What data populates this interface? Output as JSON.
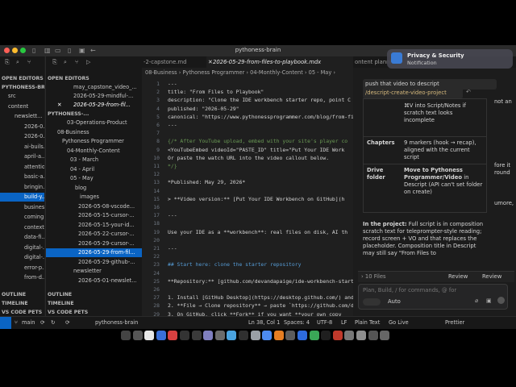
{
  "window": {
    "title": "pythoness-brain"
  },
  "notification": {
    "title": "Privacy & Security",
    "subtitle": "Notification"
  },
  "explorer": {
    "open_editors": "OPEN EDITORS",
    "workspace": "PYTHONESS-BR...",
    "rows": [
      "src",
      "content",
      "newslett...",
      "2026-0...",
      "2026-0...",
      "ai-buils...",
      "april-a...",
      "attentio...",
      "basic-a...",
      "bringin...",
      "build-y...",
      "busines...",
      "coming...",
      "context...",
      "data-fi...",
      "digital-...",
      "digital-...",
      "error-p...",
      "from-d..."
    ],
    "outline": "OUTLINE",
    "timeline": "TIMELINE",
    "vs_code_pets": "VS CODE PETS"
  },
  "explorer2": {
    "open_editors": "OPEN EDITORS",
    "editor1": "may_capstone_video_...",
    "editor2": "2026-05-29-mindful-...",
    "editor3": "2026-05-29-from-fil...",
    "workspace": "PYTHONESS-...",
    "tree": [
      "03-Operations-Product",
      "08-Business",
      "Pythoness Programmer",
      "04-Monthly-Content",
      "03 - March",
      "04 - April",
      "05 - May",
      "blog",
      "images",
      "2026-05-08-vscode...",
      "2026-05-15-cursor-...",
      "2026-05-15-your-id...",
      "2026-05-22-cursor-...",
      "2026-05-29-cursor-...",
      "2026-05-29-from-fil...",
      "2026-05-29-github-...",
      "newsletter",
      "2026-05-01-newslet..."
    ],
    "outline": "OUTLINE",
    "timeline": "TIMELINE",
    "vs_code_pets": "VS CODE PETS"
  },
  "tabs": [
    "-2-capstone.md",
    "2026-05-29-from-files-to-playbook.mdx",
    "ontent planni"
  ],
  "breadcrumbs": "08-Business  ›  Pythoness Programmer  ›  04-Monthly-Content  ›  05 - May  ›",
  "editor_lines": [
    {
      "n": "1",
      "t": "---"
    },
    {
      "n": "2",
      "t": "title: \"From Files to Playbook\""
    },
    {
      "n": "3",
      "t": "description: \"Clone the IDE workbench starter repo, point C"
    },
    {
      "n": "4",
      "t": "published: \"2026-05-29\""
    },
    {
      "n": "5",
      "t": "canonical: \"https://www.pythonessprogrammer.com/blog/from-fil"
    },
    {
      "n": "6",
      "t": "---"
    },
    {
      "n": "7",
      "t": ""
    },
    {
      "n": "8",
      "t": "{/* After YouTube upload, embed with your site's player co"
    },
    {
      "n": "9",
      "t": "<YouTubeEmbed videoId=\"PASTE_ID\" title=\"Put Your IDE Work"
    },
    {
      "n": "10",
      "t": "Or paste the watch URL into the video callout below."
    },
    {
      "n": "11",
      "t": "*/}"
    },
    {
      "n": "12",
      "t": ""
    },
    {
      "n": "13",
      "t": "*Published: May 29, 2026*"
    },
    {
      "n": "14",
      "t": ""
    },
    {
      "n": "15",
      "t": "> **Video version:** [Put Your IDE Workbench on GitHub](h"
    },
    {
      "n": "16",
      "t": ""
    },
    {
      "n": "17",
      "t": "---"
    },
    {
      "n": "18",
      "t": ""
    },
    {
      "n": "19",
      "t": "Use your IDE as a **workbench**: real files on disk, AI th"
    },
    {
      "n": "20",
      "t": ""
    },
    {
      "n": "21",
      "t": "---"
    },
    {
      "n": "22",
      "t": ""
    },
    {
      "n": "23",
      "t": "## Start here: clone the starter repository"
    },
    {
      "n": "24",
      "t": ""
    },
    {
      "n": "25",
      "t": "**Repository:** [github.com/devandapaige/ide-workbench-starte"
    },
    {
      "n": "26",
      "t": ""
    },
    {
      "n": "27",
      "t": "1. Install [GitHub Desktop](https://desktop.github.com/) and si"
    },
    {
      "n": "28",
      "t": "2. **File → Clone repository** → paste `https://github.com/de"
    },
    {
      "n": "29",
      "t": "3. On GitHub, click **Fork** if you want **your own copy"
    }
  ],
  "chat": {
    "top_line": "push that video to descript",
    "command_chip": "/descript-create-video-project",
    "row0_text": "⌘V into Script/Notes if scratch text looks incomplete",
    "row1_label": "Chapters",
    "row1_text": "9 markers (hook → recap), aligned with the current script",
    "row2_label": "Drive folder",
    "row2_text_bold": "Move to Pythoness Programmer/Video",
    "row2_text": " in Descript (API can't set folder on create)",
    "project_label": "In the project:",
    "project_text": " Full script is in composition scratch text for teleprompter-style reading; record screen + VO and that replaces the placeholder. Composition title in Descript may still say \"From Files to",
    "files_label": "› 10 Files",
    "review_label": "Review",
    "review2_label": "Review",
    "input_placeholder": "Plan, Build, / for commands, @ for",
    "mode_label": "Auto",
    "side_text": [
      "not an",
      "fore it",
      "round",
      "umore,"
    ]
  },
  "status": {
    "branch": "main",
    "workspace": "pythoness-brain",
    "position": "Ln 38, Col 1",
    "spaces": "Spaces: 4",
    "encoding": "UTF-8",
    "eol": "LF",
    "language": "Plain Text",
    "golive": "Go Live",
    "prettier": "Prettier"
  },
  "colors": {
    "accent": "#0a64c4",
    "heading": "#569cd6",
    "link": "#3794ff"
  }
}
